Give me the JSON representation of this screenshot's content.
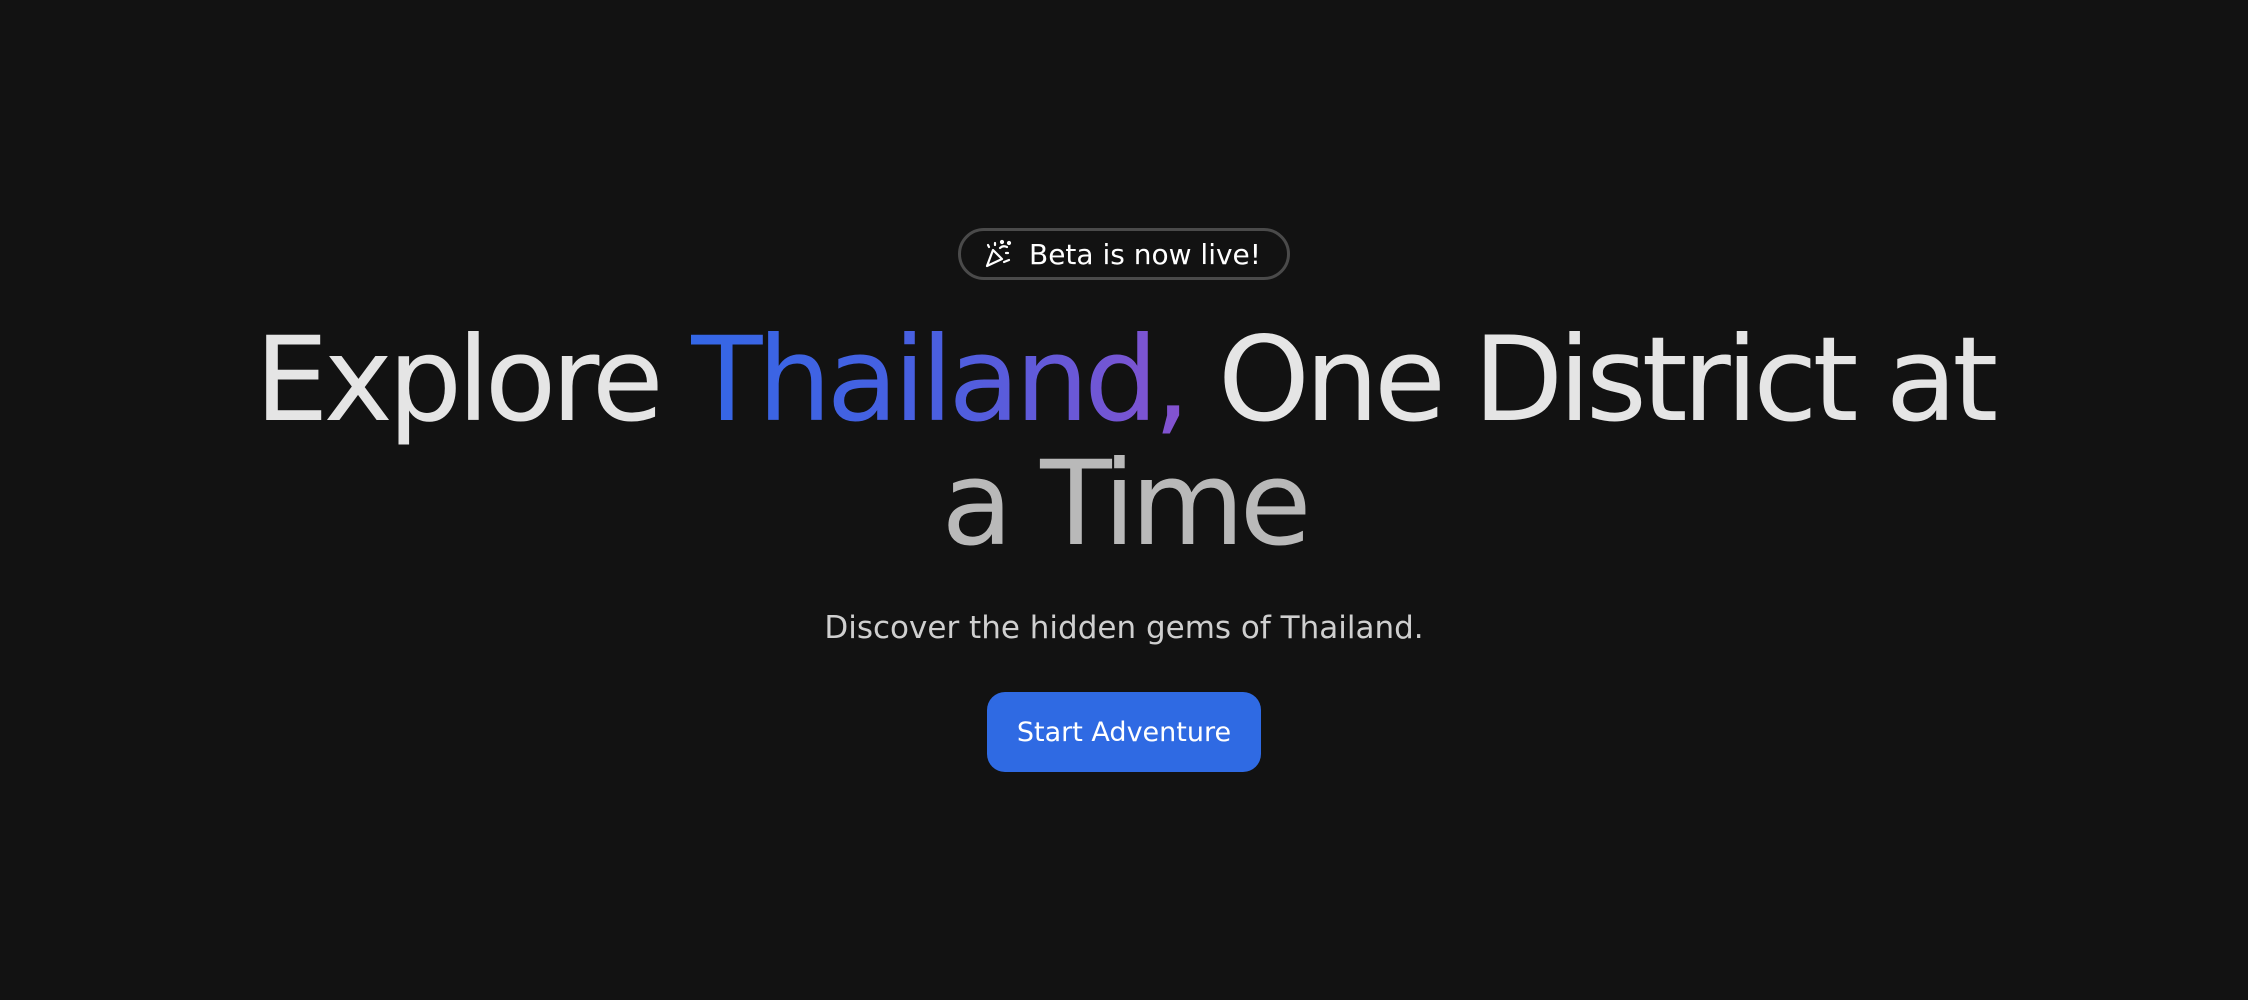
{
  "badge": {
    "icon": "party-popper-icon",
    "label": "Beta is now live!"
  },
  "headline": {
    "before_accent": "Explore ",
    "accent": "Thailand,",
    "after_accent": " One District at",
    "line2": "a Time"
  },
  "colors": {
    "background": "#121212",
    "accent_gradient_start": "#3467e6",
    "accent_gradient_end": "#8552cf",
    "button": "#2f6ae3"
  },
  "subtitle": "Discover the hidden gems of Thailand.",
  "cta": {
    "label": "Start Adventure"
  }
}
